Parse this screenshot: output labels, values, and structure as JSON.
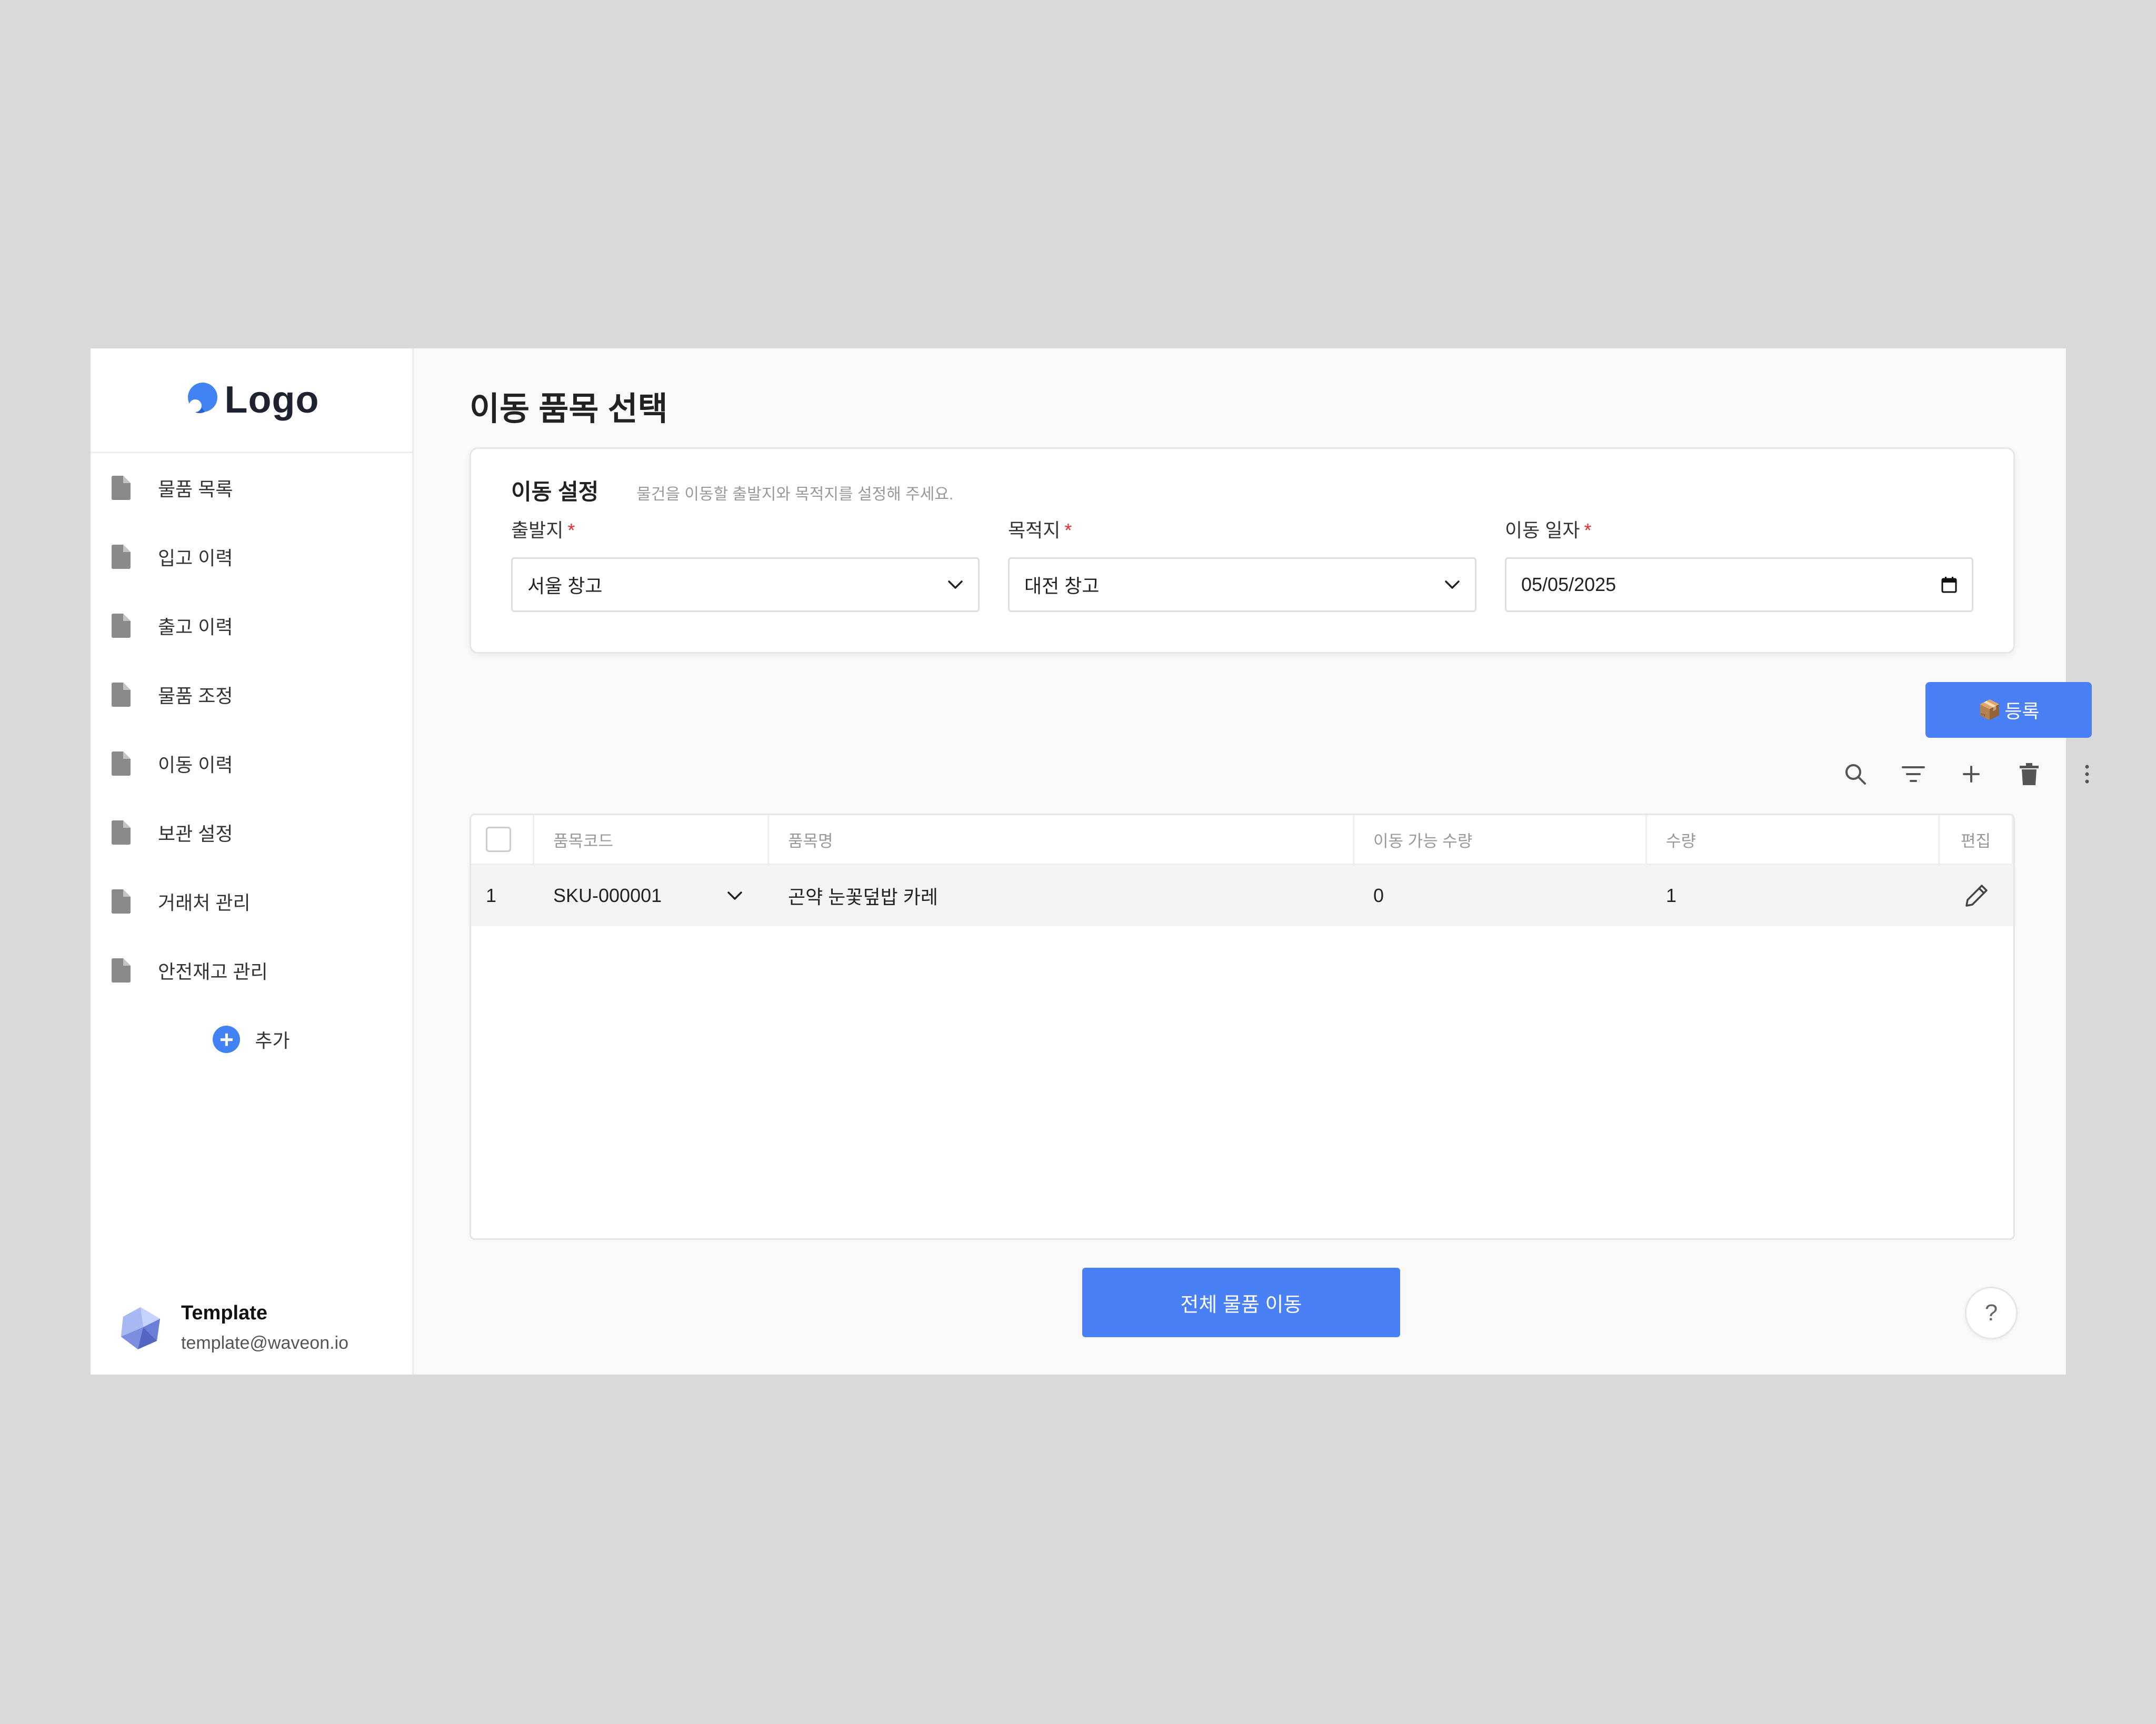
{
  "brand": {
    "logo_text": "Logo",
    "accent_color": "#4183f4"
  },
  "sidebar": {
    "items": [
      {
        "label": "물품 목록",
        "icon": "document-icon"
      },
      {
        "label": "입고 이력",
        "icon": "document-icon"
      },
      {
        "label": "출고 이력",
        "icon": "document-icon"
      },
      {
        "label": "물품 조정",
        "icon": "document-icon"
      },
      {
        "label": "이동 이력",
        "icon": "document-icon"
      },
      {
        "label": "보관 설정",
        "icon": "document-icon"
      },
      {
        "label": "거래처 관리",
        "icon": "document-icon"
      },
      {
        "label": "안전재고 관리",
        "icon": "document-icon"
      }
    ],
    "add_label": "추가",
    "profile": {
      "name": "Template",
      "email": "template@waveon.io"
    }
  },
  "main": {
    "title": "이동 품목 선택",
    "settings": {
      "title": "이동 설정",
      "description": "물건을 이동할 출발지와 목적지를 설정해 주세요.",
      "required_mark": "*",
      "origin": {
        "label": "출발지",
        "value": "서울 창고"
      },
      "destination": {
        "label": "목적지",
        "value": "대전 창고"
      },
      "date": {
        "label": "이동 일자",
        "value": "05/05/2025"
      }
    },
    "register_button": {
      "icon": "📦",
      "label": "등록"
    },
    "toolbar": [
      "search-icon",
      "filter-icon",
      "plus-icon",
      "trash-icon",
      "more-vertical-icon"
    ],
    "table": {
      "columns": [
        "품목코드",
        "품목명",
        "이동 가능 수량",
        "수량",
        "편집"
      ],
      "rows": [
        {
          "index": "1",
          "code": "SKU-000001",
          "name": "곤약 눈꽃덮밥 카레",
          "available": "0",
          "quantity": "1"
        }
      ]
    },
    "move_all_button": "전체 물품 이동",
    "help_button": "?"
  }
}
